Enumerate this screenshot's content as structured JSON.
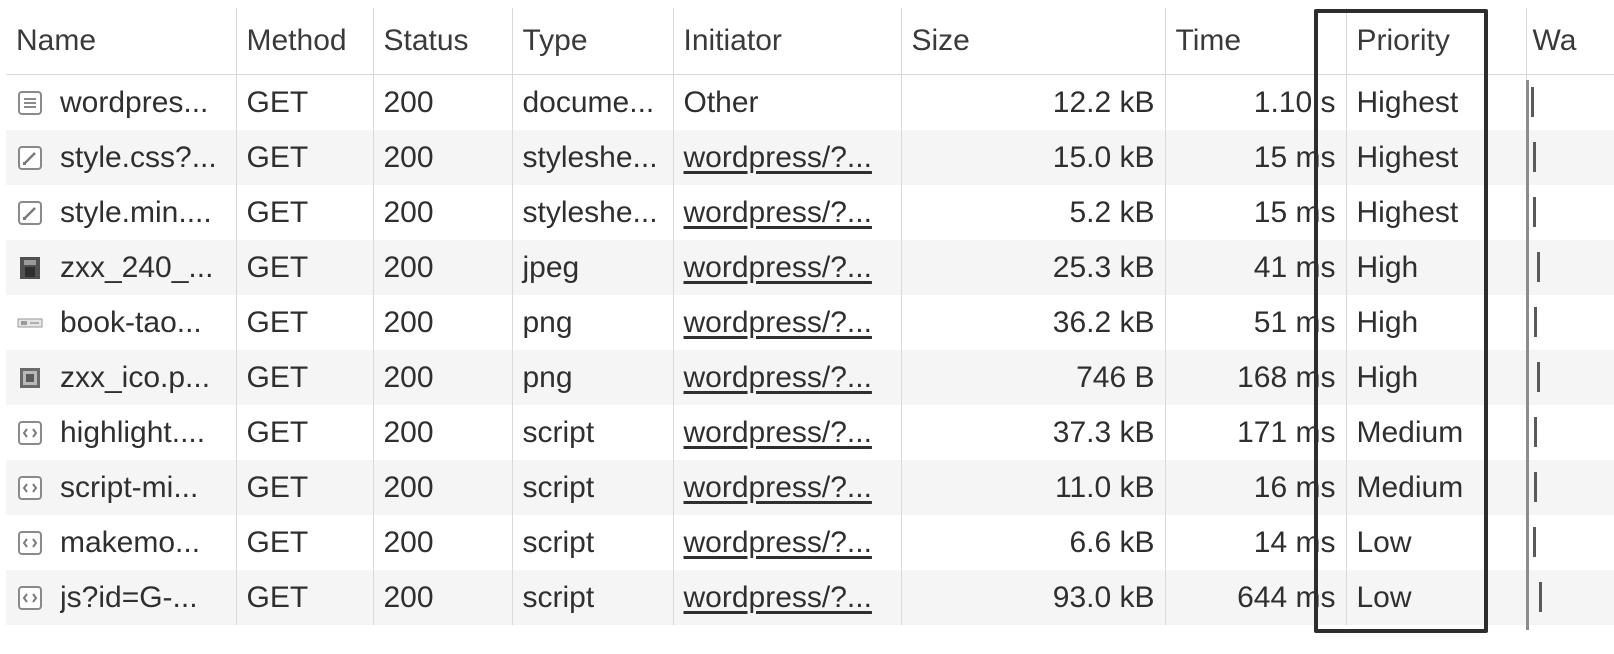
{
  "columns": {
    "name": "Name",
    "method": "Method",
    "status": "Status",
    "type": "Type",
    "initiator": "Initiator",
    "size": "Size",
    "time": "Time",
    "priority": "Priority",
    "waterfall": "Wa"
  },
  "rows": [
    {
      "icon": "document-icon",
      "name": "wordpres...",
      "method": "GET",
      "status": "200",
      "type": "docume...",
      "initiator": "Other",
      "initiator_link": false,
      "size": "12.2 kB",
      "time": "1.10 s",
      "priority": "Highest"
    },
    {
      "icon": "stylesheet-icon",
      "name": "style.css?...",
      "method": "GET",
      "status": "200",
      "type": "styleshe...",
      "initiator": "wordpress/?...",
      "initiator_link": true,
      "size": "15.0 kB",
      "time": "15 ms",
      "priority": "Highest"
    },
    {
      "icon": "stylesheet-icon",
      "name": "style.min....",
      "method": "GET",
      "status": "200",
      "type": "styleshe...",
      "initiator": "wordpress/?...",
      "initiator_link": true,
      "size": "5.2 kB",
      "time": "15 ms",
      "priority": "Highest"
    },
    {
      "icon": "image-thumbnail-icon",
      "name": "zxx_240_...",
      "method": "GET",
      "status": "200",
      "type": "jpeg",
      "initiator": "wordpress/?...",
      "initiator_link": true,
      "size": "25.3 kB",
      "time": "41 ms",
      "priority": "High"
    },
    {
      "icon": "image-banner-icon",
      "name": "book-tao...",
      "method": "GET",
      "status": "200",
      "type": "png",
      "initiator": "wordpress/?...",
      "initiator_link": true,
      "size": "36.2 kB",
      "time": "51 ms",
      "priority": "High"
    },
    {
      "icon": "image-ico-icon",
      "name": "zxx_ico.p...",
      "method": "GET",
      "status": "200",
      "type": "png",
      "initiator": "wordpress/?...",
      "initiator_link": true,
      "size": "746 B",
      "time": "168 ms",
      "priority": "High"
    },
    {
      "icon": "script-icon",
      "name": "highlight....",
      "method": "GET",
      "status": "200",
      "type": "script",
      "initiator": "wordpress/?...",
      "initiator_link": true,
      "size": "37.3 kB",
      "time": "171 ms",
      "priority": "Medium"
    },
    {
      "icon": "script-icon",
      "name": "script-mi...",
      "method": "GET",
      "status": "200",
      "type": "script",
      "initiator": "wordpress/?...",
      "initiator_link": true,
      "size": "11.0 kB",
      "time": "16 ms",
      "priority": "Medium"
    },
    {
      "icon": "script-icon",
      "name": "makemo...",
      "method": "GET",
      "status": "200",
      "type": "script",
      "initiator": "wordpress/?...",
      "initiator_link": true,
      "size": "6.6 kB",
      "time": "14 ms",
      "priority": "Low"
    },
    {
      "icon": "script-icon",
      "name": "js?id=G-...",
      "method": "GET",
      "status": "200",
      "type": "script",
      "initiator": "wordpress/?...",
      "initiator_link": true,
      "size": "93.0 kB",
      "time": "644 ms",
      "priority": "Low"
    }
  ],
  "colors": {
    "grid_line": "#d9d9d9",
    "row_stripe": "#f5f5f5",
    "highlight_border": "#2d2d2d",
    "waterfall_line": "#8c8c8c"
  }
}
